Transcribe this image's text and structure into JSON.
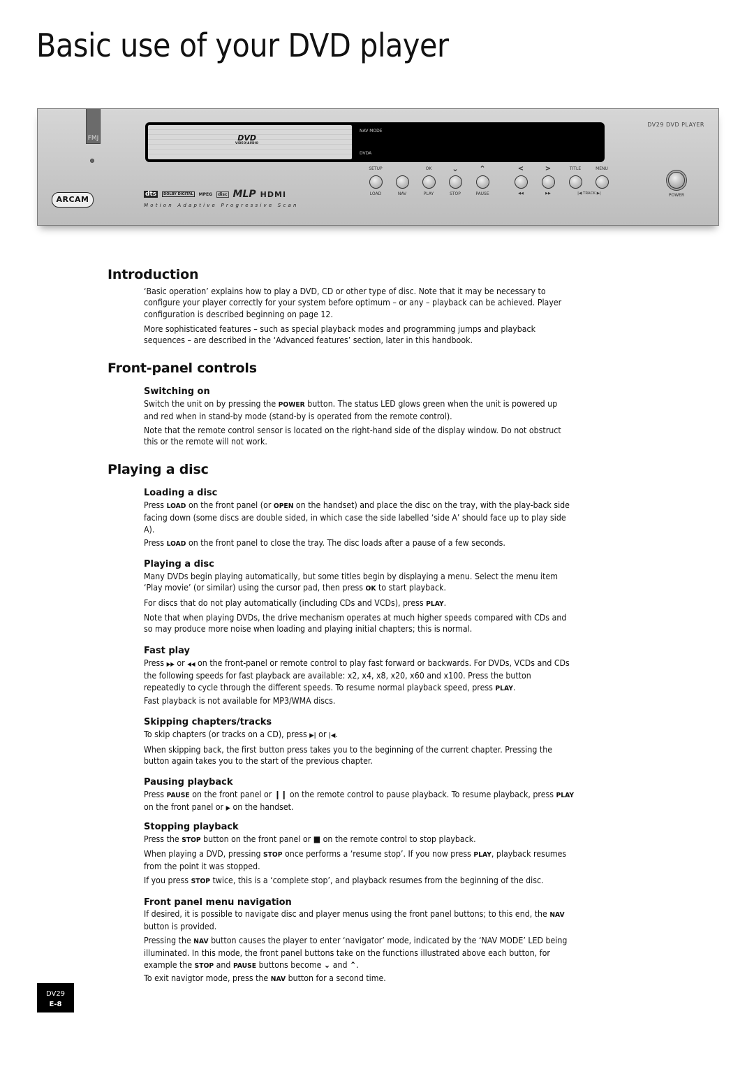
{
  "page": {
    "title": "Basic use of your DVD player",
    "footer_model": "DV29",
    "footer_page": "E-8"
  },
  "device": {
    "brand_tab": "FMJ",
    "brand_logo": "ARCAM",
    "model_label": "DV29 DVD PLAYER",
    "display_labels": {
      "nav_mode": "NAV MODE",
      "dvda": "DVDA"
    },
    "tray_logo": {
      "main": "DVD",
      "sub": "VIDEO/AUDIO"
    },
    "format_logos": [
      "dts",
      "DOLBY DIGITAL",
      "MPEG",
      "disc",
      "MLP",
      "HDMI"
    ],
    "tagline": "Motion Adaptive Progressive Scan",
    "buttons": [
      {
        "top": "SETUP",
        "bottom": "LOAD"
      },
      {
        "top": "",
        "bottom": "NAV"
      },
      {
        "top": "OK",
        "bottom": "PLAY"
      },
      {
        "top": "⌄",
        "bottom": "STOP"
      },
      {
        "top": "⌃",
        "bottom": "PAUSE"
      },
      {
        "top": "<",
        "bottom": "◀◀"
      },
      {
        "top": ">",
        "bottom": "▶▶"
      },
      {
        "top": "TITLE",
        "bottom": "|◀ TRACK ▶|"
      },
      {
        "top": "MENU",
        "bottom": ""
      }
    ],
    "power_label": "POWER"
  },
  "sections": {
    "introduction": {
      "heading": "Introduction",
      "p1": "‘Basic operation’ explains how to play a DVD, CD or other type of disc. Note that it may be necessary to configure your player correctly for your system before optimum – or any – playback can be achieved. Player configuration is described beginning on page 12.",
      "p2": "More sophisticated features – such as special playback modes and programming jumps and playback sequences – are described in the ‘Advanced features’ section, later in this handbook."
    },
    "front_panel": {
      "heading": "Front-panel controls",
      "switching_on": {
        "heading": "Switching on",
        "p1_a": "Switch the unit on by pressing the ",
        "p1_b": "POWER",
        "p1_c": " button. The status LED glows green when the unit is powered up and red when in stand-by mode (stand-by is operated from the remote control).",
        "p2": "Note that the remote control sensor is located on the right-hand side of the display window. Do not obstruct this or the remote will not work."
      }
    },
    "playing": {
      "heading": "Playing a disc",
      "loading": {
        "heading": "Loading a disc",
        "p1_a": "Press ",
        "p1_b": "LOAD",
        "p1_c": " on the front panel (or ",
        "p1_d": "OPEN",
        "p1_e": " on the handset) and place the disc on the tray, with the play-back side facing down (some discs are double sided, in which case the side labelled ‘side A’ should face up to play side A).",
        "p2_a": "Press ",
        "p2_b": "LOAD",
        "p2_c": " on the front panel to close the tray. The disc loads after a pause of a few seconds."
      },
      "playing_disc": {
        "heading": "Playing a disc",
        "p1_a": "Many DVDs begin playing automatically, but some titles begin by displaying a menu. Select the menu item ‘Play movie’ (or similar) using the cursor pad, then press ",
        "p1_b": "OK",
        "p1_c": " to start playback.",
        "p2_a": "For discs that do not play automatically (including CDs and VCDs), press ",
        "p2_b": "PLAY",
        "p2_c": ".",
        "p3": "Note that when playing DVDs, the drive mechanism operates at much higher speeds compared with CDs and so may produce more noise when loading and playing initial chapters; this is normal."
      },
      "fast_play": {
        "heading": "Fast play",
        "p1_a": "Press ",
        "ff_icon": "▶▶",
        "p1_b": " or ",
        "rew_icon": "◀◀",
        "p1_c": " on the front-panel or remote control to play fast forward or backwards. For DVDs, VCDs and CDs the following speeds for fast playback are available: x2, x4, x8, x20, x60 and x100. Press the button repeatedly to cycle through the different speeds. To resume normal playback speed, press ",
        "p1_d": "PLAY",
        "p1_e": ".",
        "p2": "Fast playback is not available for MP3/WMA discs."
      },
      "skipping": {
        "heading": "Skipping chapters/tracks",
        "p1_a": "To skip chapters (or tracks on a CD), press ",
        "next_icon": "▶|",
        "p1_b": " or ",
        "prev_icon": "|◀",
        "p1_c": ".",
        "p2": "When skipping back, the first button press takes you to the beginning of the current chapter. Pressing the button again takes you to the start of the previous chapter."
      },
      "pausing": {
        "heading": "Pausing playback",
        "p1_a": "Press ",
        "p1_b": "PAUSE",
        "p1_c": " on the front panel or ",
        "pause_icon": "❙❙",
        "p1_d": " on the remote control to pause playback. To resume playback, press ",
        "p1_e": "PLAY",
        "p1_f": " on the front panel or ",
        "play_icon": "▶",
        "p1_g": " on the handset."
      },
      "stopping": {
        "heading": "Stopping playback",
        "p1_a": "Press the ",
        "p1_b": "STOP",
        "p1_c": " button on the front panel or ",
        "stop_icon": "■",
        "p1_d": " on the remote control to stop playback.",
        "p2_a": "When playing a DVD, pressing ",
        "p2_b": "STOP",
        "p2_c": " once performs a ‘resume stop’. If you now press ",
        "p2_d": "PLAY",
        "p2_e": ", playback resumes from the point it was stopped.",
        "p3_a": "If you press ",
        "p3_b": "STOP",
        "p3_c": " twice, this is a ‘complete stop’, and playback resumes from the beginning of the disc."
      },
      "navigation": {
        "heading": "Front panel menu navigation",
        "p1_a": "If desired, it is possible to navigate disc and player menus using the front panel buttons; to this end, the ",
        "p1_b": "NAV",
        "p1_c": " button is provided.",
        "p2_a": "Pressing the ",
        "p2_b": "NAV",
        "p2_c": " button causes the player to enter ‘navigator’ mode, indicated by the ‘NAV MODE’ LED being illuminated. In this mode, the front panel buttons take on the functions illustrated above each button, for example the ",
        "p2_d": "STOP",
        "p2_e": " and ",
        "p2_f": "PAUSE",
        "p2_g": " buttons become ",
        "down_icon": "⌄",
        "p2_h": " and ",
        "up_icon": "⌃",
        "p2_i": ".",
        "p3_a": "To exit navigtor mode, press the ",
        "p3_b": "NAV",
        "p3_c": " button for a second time."
      }
    }
  }
}
